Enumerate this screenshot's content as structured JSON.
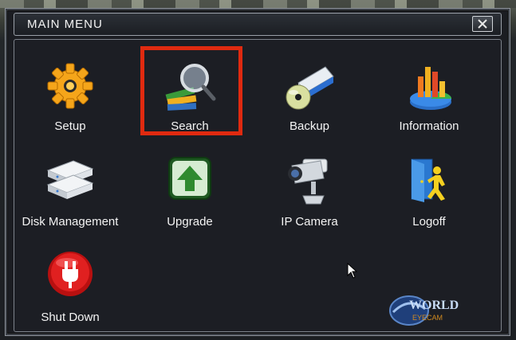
{
  "window": {
    "title": "MAIN MENU",
    "close_icon": "close-icon"
  },
  "menu": {
    "items": [
      {
        "label": "Setup",
        "icon": "gear-icon"
      },
      {
        "label": "Search",
        "icon": "search-books-icon",
        "selected": true
      },
      {
        "label": "Backup",
        "icon": "backup-drive-icon"
      },
      {
        "label": "Information",
        "icon": "chart-info-icon"
      },
      {
        "label": "Disk Management",
        "icon": "disk-stack-icon"
      },
      {
        "label": "Upgrade",
        "icon": "upgrade-arrow-icon"
      },
      {
        "label": "IP Camera",
        "icon": "camera-icon"
      },
      {
        "label": "Logoff",
        "icon": "logoff-door-icon"
      },
      {
        "label": "Shut Down",
        "icon": "power-plug-icon"
      }
    ]
  },
  "logo": {
    "line1": "WORLD",
    "line2": "EYECAM"
  },
  "colors": {
    "highlight": "#e02a10",
    "panel_bg": "#1c1e24",
    "text": "#f4f4f4"
  }
}
